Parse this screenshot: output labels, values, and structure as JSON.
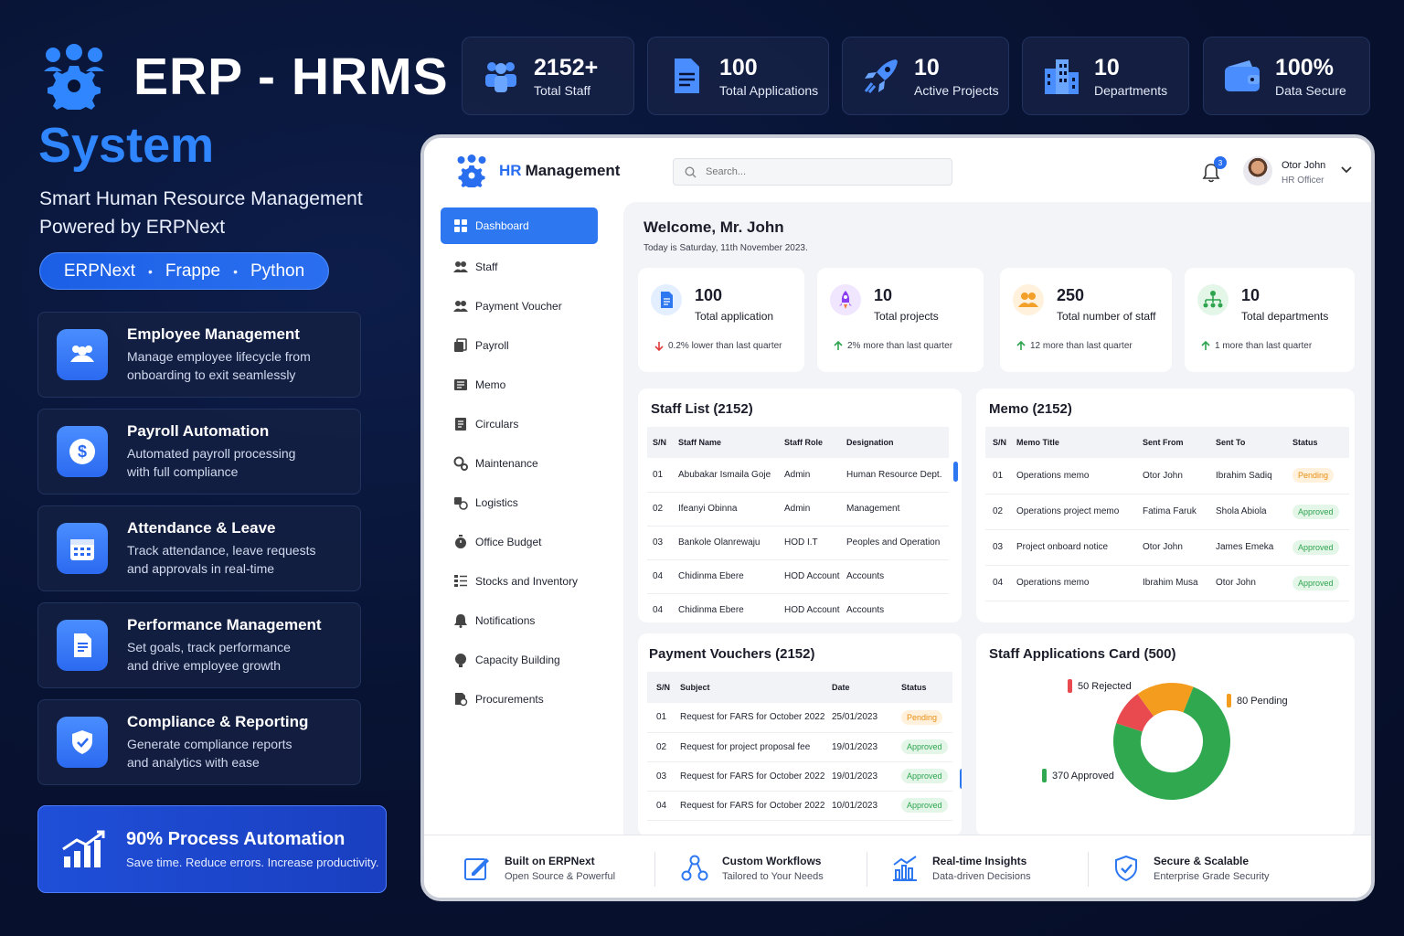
{
  "hero": {
    "title": "ERP - HRMS",
    "subtitle": "System",
    "tagline_1": "Smart Human Resource Management",
    "tagline_2": "Powered by ERPNext",
    "tech": [
      "ERPNext",
      "Frappe",
      "Python"
    ],
    "tech_sep": "•"
  },
  "features": [
    {
      "title": "Employee Management",
      "desc": "Manage employee lifecycle from\nonboarding to exit seamlessly",
      "icon": "people-icon"
    },
    {
      "title": "Payroll Automation",
      "desc": "Automated payroll processing\nwith full compliance",
      "icon": "dollar-icon"
    },
    {
      "title": "Attendance & Leave",
      "desc": "Track attendance, leave requests\nand approvals in real-time",
      "icon": "calendar-icon"
    },
    {
      "title": "Performance Management",
      "desc": "Set goals, track performance\nand drive employee growth",
      "icon": "document-icon"
    },
    {
      "title": "Compliance & Reporting",
      "desc": "Generate compliance reports\nand analytics with ease",
      "icon": "shield-icon"
    }
  ],
  "automation": {
    "title": "90% Process Automation",
    "desc": "Save time. Reduce errors. Increase productivity."
  },
  "stats": [
    {
      "value": "2152+",
      "label": "Total Staff"
    },
    {
      "value": "100",
      "label": "Total Applications"
    },
    {
      "value": "10",
      "label": "Active Projects"
    },
    {
      "value": "10",
      "label": "Departments"
    },
    {
      "value": "100%",
      "label": "Data Secure"
    }
  ],
  "app": {
    "brand_1": "HR",
    "brand_2": "Management",
    "search_placeholder": "Search...",
    "notifications": "3",
    "user_name": "Otor John",
    "user_role": "HR Officer",
    "nav": [
      "Dashboard",
      "Staff",
      "Payment Voucher",
      "Payroll",
      "Memo",
      "Circulars",
      "Maintenance",
      "Logistics",
      "Office Budget",
      "Stocks and Inventory",
      "Notifications",
      "Capacity Building",
      "Procurements"
    ],
    "welcome": "Welcome, Mr. John",
    "today": "Today is Saturday, 11th November 2023.",
    "kpis": [
      {
        "value": "100",
        "label": "Total application",
        "trend": "0.2% lower than last quarter",
        "dir": "down"
      },
      {
        "value": "10",
        "label": "Total projects",
        "trend": "2% more than last quarter",
        "dir": "up"
      },
      {
        "value": "250",
        "label": "Total number of staff",
        "trend": "12 more than last quarter",
        "dir": "up"
      },
      {
        "value": "10",
        "label": "Total departments",
        "trend": "1 more than last quarter",
        "dir": "up"
      }
    ],
    "staff": {
      "title": "Staff List (2152)",
      "headers": [
        "S/N",
        "Staff Name",
        "Staff Role",
        "Designation"
      ],
      "rows": [
        [
          "01",
          "Abubakar Ismaila Goje",
          "Admin",
          "Human Resource Dept."
        ],
        [
          "02",
          "Ifeanyi Obinna",
          "Admin",
          "Management"
        ],
        [
          "03",
          "Bankole Olanrewaju",
          "HOD I.T",
          "Peoples and Operation"
        ],
        [
          "04",
          "Chidinma Ebere",
          "HOD Account",
          "Accounts"
        ],
        [
          "04",
          "Chidinma Ebere",
          "HOD Account",
          "Accounts"
        ]
      ]
    },
    "memo": {
      "title": "Memo (2152)",
      "headers": [
        "S/N",
        "Memo Title",
        "Sent From",
        "Sent To",
        "Status"
      ],
      "rows": [
        [
          "01",
          "Operations memo",
          "Otor John",
          "Ibrahim Sadiq",
          "Pending"
        ],
        [
          "02",
          "Operations project memo",
          "Fatima Faruk",
          "Shola Abiola",
          "Approved"
        ],
        [
          "03",
          "Project onboard notice",
          "Otor John",
          "James Emeka",
          "Approved"
        ],
        [
          "04",
          "Operations memo",
          "Ibrahim Musa",
          "Otor John",
          "Approved"
        ]
      ]
    },
    "vouchers": {
      "title": "Payment Vouchers (2152)",
      "headers": [
        "S/N",
        "Subject",
        "Date",
        "Status"
      ],
      "rows": [
        [
          "01",
          "Request for FARS for October 2022",
          "25/01/2023",
          "Pending"
        ],
        [
          "02",
          "Request for project proposal fee",
          "19/01/2023",
          "Approved"
        ],
        [
          "03",
          "Request for FARS for October 2022",
          "19/01/2023",
          "Approved"
        ],
        [
          "04",
          "Request for FARS for October 2022",
          "10/01/2023",
          "Approved"
        ]
      ]
    },
    "applications": {
      "title": "Staff Applications Card (500)",
      "legend": [
        "50 Rejected",
        "80 Pending",
        "370 Approved"
      ]
    },
    "footer": [
      {
        "title": "Built on ERPNext",
        "desc": "Open Source & Powerful"
      },
      {
        "title": "Custom Workflows",
        "desc": "Tailored to Your Needs"
      },
      {
        "title": "Real-time Insights",
        "desc": "Data-driven Decisions"
      },
      {
        "title": "Secure & Scalable",
        "desc": "Enterprise Grade Security"
      }
    ]
  },
  "chart_data": {
    "type": "pie",
    "categories": [
      "Rejected",
      "Pending",
      "Approved"
    ],
    "values": [
      50,
      80,
      370
    ],
    "colors": [
      "#e84a4f",
      "#f39c1e",
      "#2fa84f"
    ],
    "title": "Staff Applications Card (500)"
  },
  "colors": {
    "accent": "#2d78f0",
    "pending": "#e88f12",
    "approved": "#2ea44f",
    "down": "#e23b3b"
  }
}
